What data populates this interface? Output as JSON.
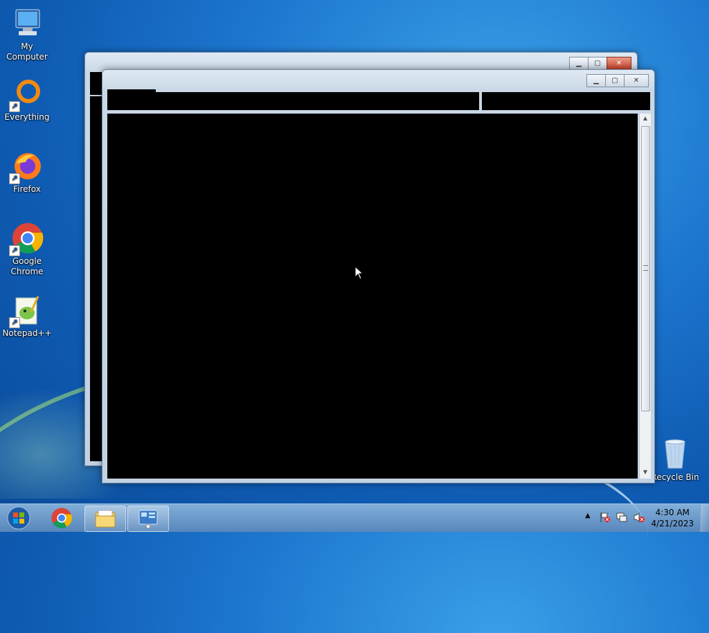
{
  "desktop": {
    "icons": [
      {
        "label": "My Computer",
        "icon": "computer-icon"
      },
      {
        "label": "Everything",
        "icon": "everything-icon"
      },
      {
        "label": "Firefox",
        "icon": "firefox-icon"
      },
      {
        "label": "Google Chrome",
        "icon": "chrome-icon"
      },
      {
        "label": "Notepad++",
        "icon": "notepadpp-icon"
      },
      {
        "label": "Recycle Bin",
        "icon": "recycle-bin-icon"
      }
    ]
  },
  "windows": {
    "back": {
      "controls": [
        "minimize",
        "maximize",
        "close"
      ]
    },
    "front": {
      "controls": [
        "minimize",
        "maximize",
        "close"
      ]
    }
  },
  "taskbar": {
    "items": [
      {
        "name": "start-button",
        "icon": "windows-orb-icon"
      },
      {
        "name": "chrome",
        "icon": "chrome-icon"
      },
      {
        "name": "explorer",
        "icon": "folder-icon"
      },
      {
        "name": "control-panel",
        "icon": "control-panel-icon"
      }
    ],
    "tray": [
      "show-hidden-icons",
      "action-center-flag-icon",
      "network-icon",
      "volume-muted-icon"
    ],
    "clock": {
      "time": "4:30 AM",
      "date": "4/21/2023"
    }
  }
}
